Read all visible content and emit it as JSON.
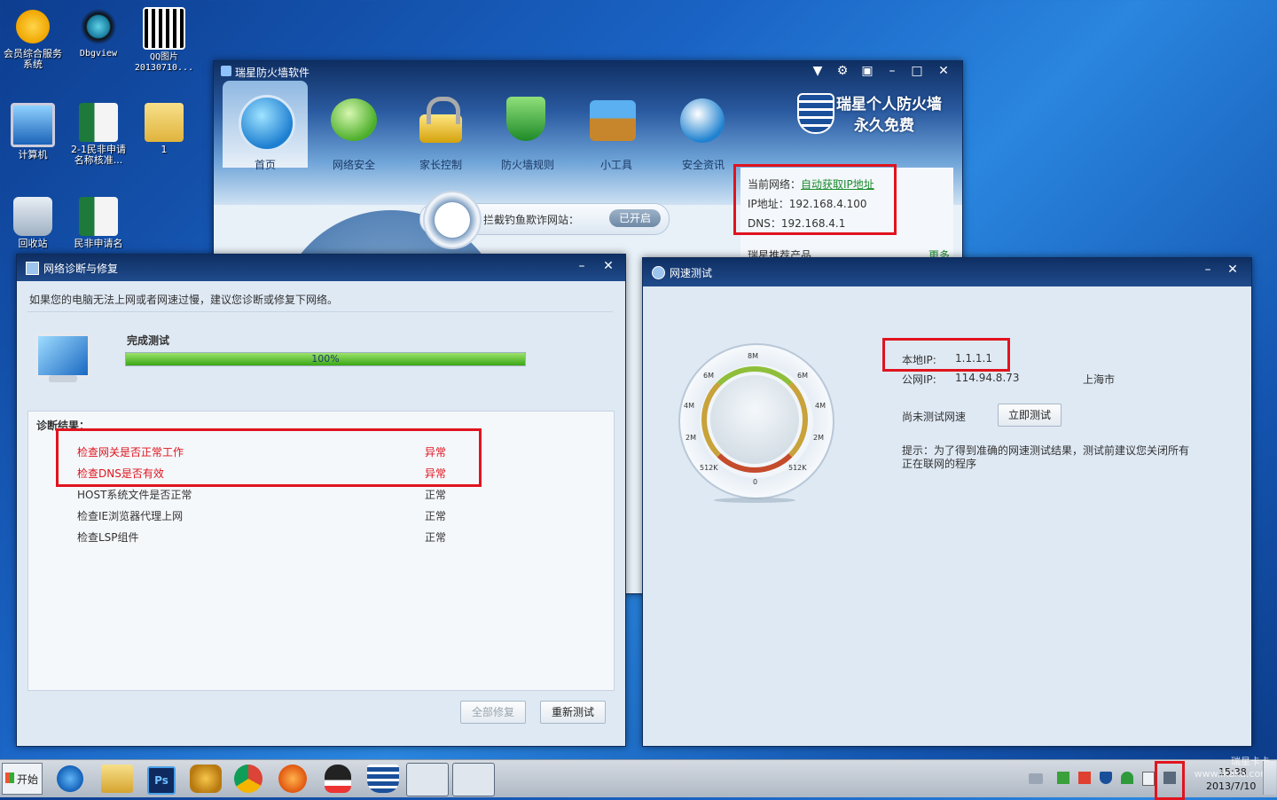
{
  "desktop": {
    "icons": [
      {
        "label": "会员综合服务系统"
      },
      {
        "label": "Dbgview"
      },
      {
        "label": "QQ图片20130710..."
      },
      {
        "label": "计算机"
      },
      {
        "label": "2-1民非申请名称核准..."
      },
      {
        "label": "1"
      },
      {
        "label": "回收站"
      },
      {
        "label": "民非申请名"
      }
    ]
  },
  "firewall": {
    "title": "瑞星防火墙软件",
    "brand_line1": "瑞星个人防火墙",
    "brand_line2": "永久免费",
    "tabs": [
      {
        "label": "首页",
        "icon": "home-icon"
      },
      {
        "label": "网络安全",
        "icon": "network-security-icon"
      },
      {
        "label": "家长控制",
        "icon": "lock-icon"
      },
      {
        "label": "防火墙规则",
        "icon": "shield-icon"
      },
      {
        "label": "小工具",
        "icon": "gear-toolbox-icon"
      },
      {
        "label": "安全资讯",
        "icon": "globe-icon"
      }
    ],
    "phishing_label": "拦截钓鱼欺诈网站：",
    "phishing_status": "已开启",
    "network_label": "当前网络：",
    "network_value": "自动获取IP地址",
    "ip_line": "IP地址：192.168.4.100",
    "dns_line": "DNS：192.168.4.1",
    "recommend_label": "瑞星推荐产品",
    "more_label": "更多"
  },
  "diagnosis": {
    "title": "网络诊断与修复",
    "hint": "如果您的电脑无法上网或者网速过慢，建议您诊断或修复下网络。",
    "status": "完成测试",
    "progress_text": "100%",
    "progress_value": 1.0,
    "results_header": "诊断结果：",
    "results": [
      {
        "item": "检查网关是否正常工作",
        "result": "异常"
      },
      {
        "item": "检查DNS是否有效",
        "result": "异常"
      },
      {
        "item": "HOST系统文件是否正常",
        "result": "正常"
      },
      {
        "item": "检查IE浏览器代理上网",
        "result": "正常"
      },
      {
        "item": "检查LSP组件",
        "result": "正常"
      }
    ],
    "repair_all": "全部修复",
    "retest": "重新测试"
  },
  "speedtest": {
    "title": "网速测试",
    "local_ip_label": "本地IP:",
    "local_ip": "1.1.1.1",
    "public_ip_label": "公网IP:",
    "public_ip": "114.94.8.73",
    "location": "上海市",
    "speed_status": "尚未测试网速",
    "test_now": "立即测试",
    "tip": "提示：为了得到准确的网速测试结果，测试前建议您关闭所有正在联网的程序",
    "gauge_labels": [
      "8M",
      "6M",
      "6M",
      "4M",
      "4M",
      "2M",
      "2M",
      "512K",
      "512K",
      "0"
    ]
  },
  "taskbar": {
    "start": "开始",
    "clock_time": "15:38",
    "clock_date": "2013/7/10",
    "watermark": "瑞星卡卡 www.ikaka.com"
  },
  "colors": {
    "alert_red": "#e0141e",
    "titlebar_dark": "#0f2f63",
    "progress_green": "#5bc52a"
  }
}
